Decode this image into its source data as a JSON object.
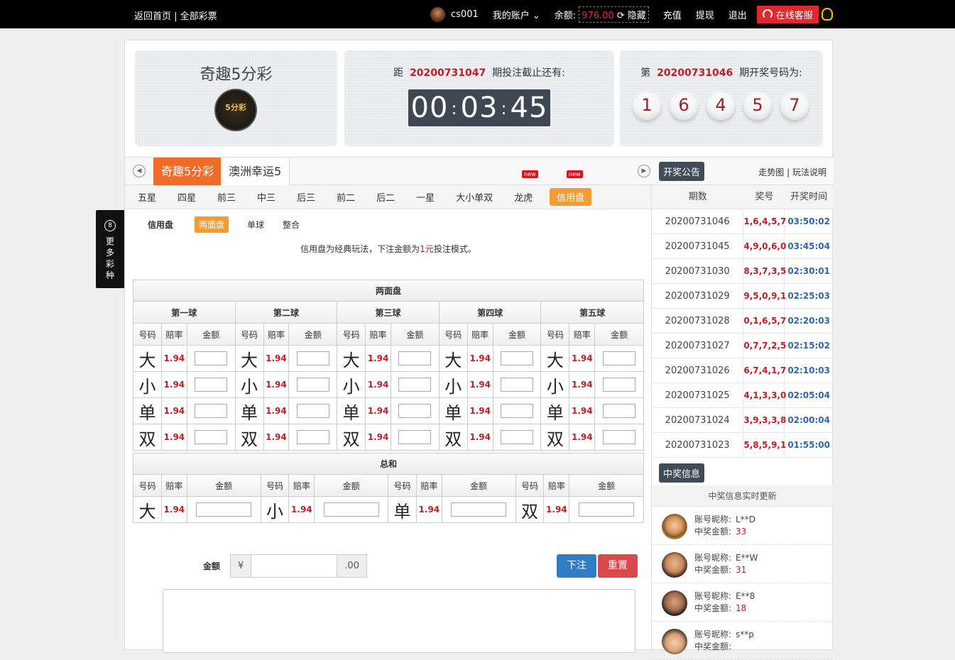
{
  "topbar": {
    "home": "返回首页",
    "sep": " | ",
    "all": "全部彩票",
    "user": "cs001",
    "account": "我的账户",
    "balance_label": "余额:",
    "balance": "976.00",
    "hide": "隐藏",
    "recharge": "充值",
    "withdraw": "提现",
    "logout": "退出",
    "service": "在线客服"
  },
  "lottery": {
    "name": "奇趣5分彩",
    "logo_text": "5分彩"
  },
  "countdown": {
    "prefix": "距",
    "issue": "20200731047",
    "suffix": "期投注截止还有:",
    "hh": "00",
    "mm": "03",
    "ss": "45"
  },
  "last_draw": {
    "prefix": "第",
    "issue": "20200731046",
    "suffix": "期开奖号码为:",
    "balls": [
      "1",
      "6",
      "4",
      "5",
      "7"
    ]
  },
  "lottery_tabs": [
    "奇趣5分彩",
    "澳洲幸运5"
  ],
  "new_badge": "new",
  "notice_btn": "开奖公告",
  "trend": "走势图",
  "rules": "玩法说明",
  "play_types": [
    "五星",
    "四星",
    "前三",
    "中三",
    "后三",
    "前二",
    "后二",
    "一星",
    "大小单双",
    "龙虎",
    "信用盘"
  ],
  "sub": {
    "title": "信用盘",
    "items": [
      "两面盘",
      "单球",
      "整合"
    ]
  },
  "desc": {
    "a": "信用盘为经典玩法，下注金额为",
    "b": "1元",
    "c": "投注模式。"
  },
  "board": {
    "title": "两面盘",
    "balls": [
      "第一球",
      "第二球",
      "第三球",
      "第四球",
      "第五球"
    ],
    "cols": {
      "num": "号码",
      "odds": "赔率",
      "amt": "金额"
    },
    "rows": [
      "大",
      "小",
      "单",
      "双"
    ],
    "odds": "1.94"
  },
  "sum": {
    "title": "总和",
    "items": [
      "大",
      "小",
      "单",
      "双"
    ],
    "odds": "1.94"
  },
  "amount": {
    "label": "金额",
    "currency": "¥",
    "suffix": ".00"
  },
  "buttons": {
    "bet": "下注",
    "reset": "重置"
  },
  "history": {
    "cols": [
      "期数",
      "奖号",
      "开奖时间"
    ],
    "rows": [
      [
        "20200731046",
        "1,6,4,5,7",
        "03:50:02"
      ],
      [
        "20200731045",
        "4,9,0,6,0",
        "03:45:04"
      ],
      [
        "20200731030",
        "8,3,7,3,5",
        "02:30:01"
      ],
      [
        "20200731029",
        "9,5,0,9,1",
        "02:25:03"
      ],
      [
        "20200731028",
        "0,1,6,5,7",
        "02:20:03"
      ],
      [
        "20200731027",
        "0,7,7,2,5",
        "02:15:02"
      ],
      [
        "20200731026",
        "6,7,4,1,7",
        "02:10:03"
      ],
      [
        "20200731025",
        "4,1,3,3,0",
        "02:05:04"
      ],
      [
        "20200731024",
        "3,9,3,3,8",
        "02:00:04"
      ],
      [
        "20200731023",
        "5,8,5,9,1",
        "01:55:00"
      ]
    ]
  },
  "win": {
    "title": "中奖信息",
    "sub": "中奖信息实时更新",
    "nick_label": "账号昵称:",
    "amt_label": "中奖金额:",
    "items": [
      {
        "nick": "L**D",
        "amt": "33"
      },
      {
        "nick": "E**W",
        "amt": "31"
      },
      {
        "nick": "E**8",
        "amt": "18"
      },
      {
        "nick": "s**p",
        "amt": ""
      }
    ]
  },
  "more": {
    "icon": "8",
    "text": [
      "更",
      "多",
      "彩",
      "种"
    ]
  }
}
